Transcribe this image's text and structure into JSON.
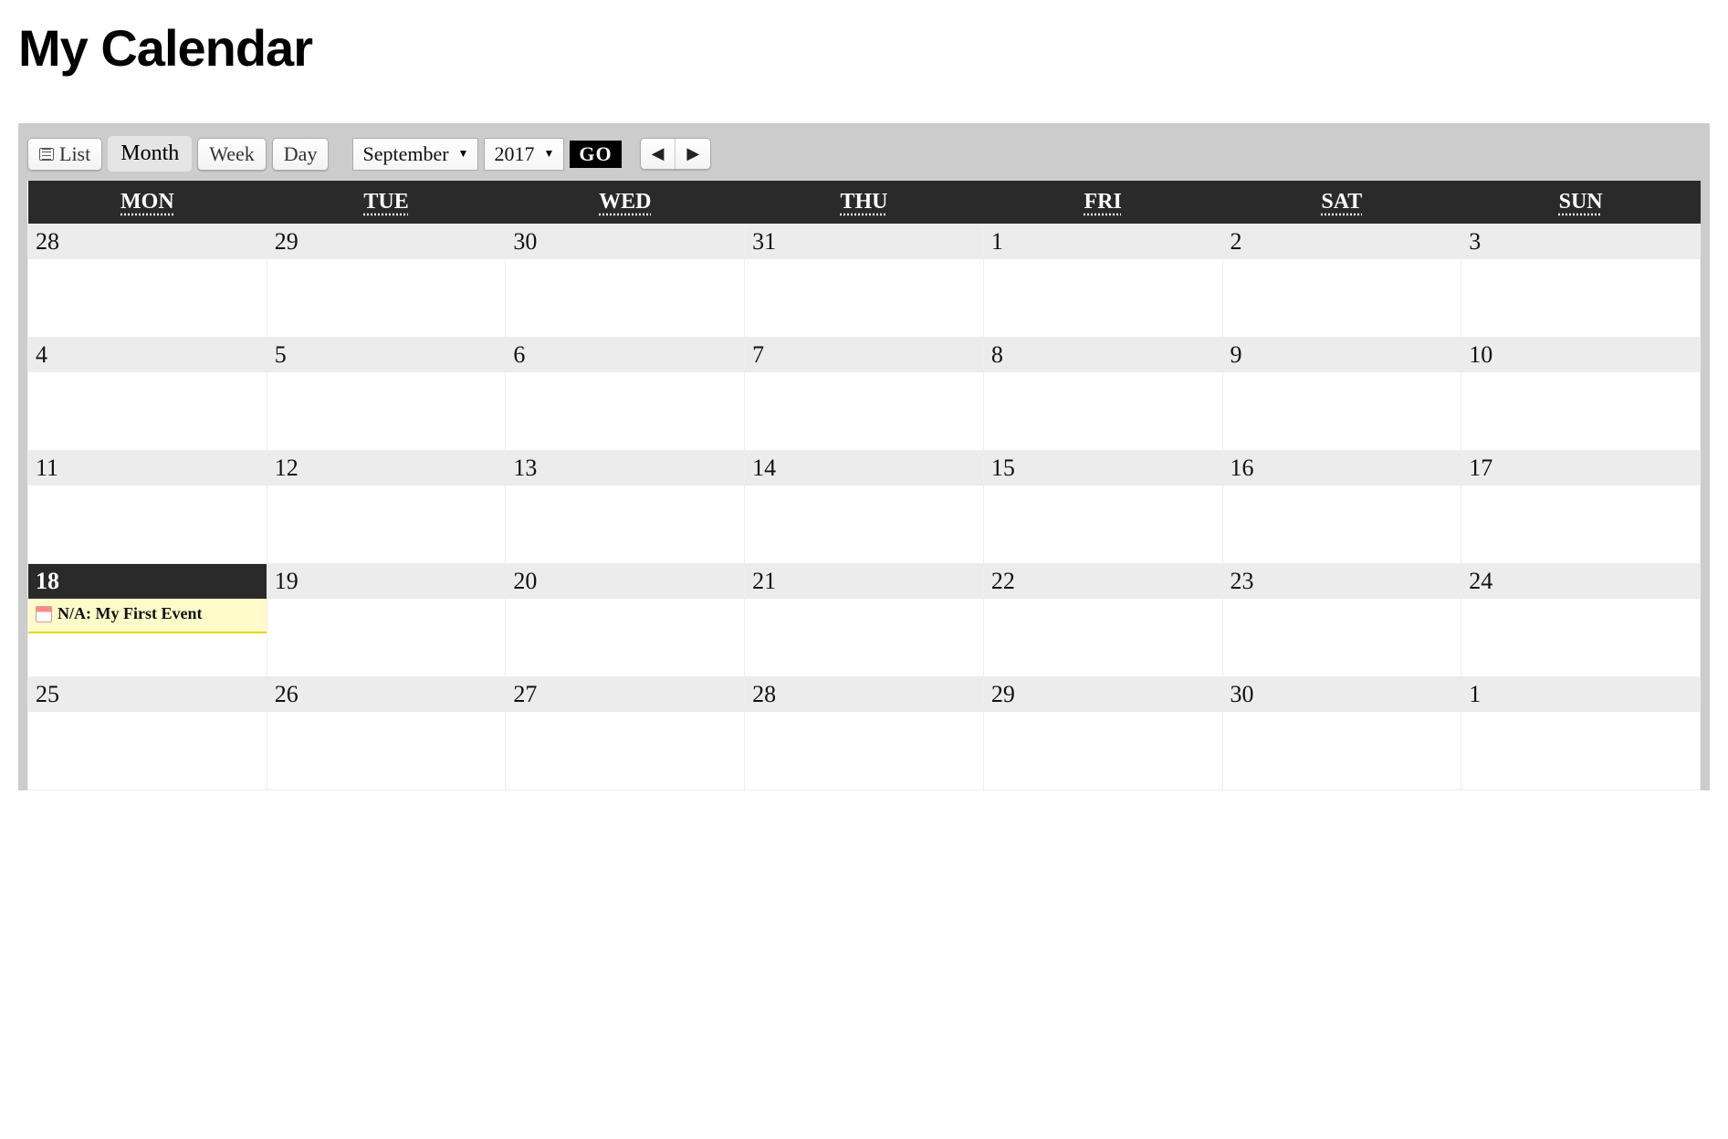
{
  "title": "My Calendar",
  "toolbar": {
    "list_label": "List",
    "month_label": "Month",
    "week_label": "Week",
    "day_label": "Day",
    "month_select": "September",
    "year_select": "2017",
    "go_label": "GO"
  },
  "headers": [
    "MON",
    "TUE",
    "WED",
    "THU",
    "FRI",
    "SAT",
    "SUN"
  ],
  "weeks": [
    [
      "28",
      "29",
      "30",
      "31",
      "1",
      "2",
      "3"
    ],
    [
      "4",
      "5",
      "6",
      "7",
      "8",
      "9",
      "10"
    ],
    [
      "11",
      "12",
      "13",
      "14",
      "15",
      "16",
      "17"
    ],
    [
      "18",
      "19",
      "20",
      "21",
      "22",
      "23",
      "24"
    ],
    [
      "25",
      "26",
      "27",
      "28",
      "29",
      "30",
      "1"
    ]
  ],
  "today": "18",
  "event": {
    "day": "18",
    "text": "N/A: My First Event"
  }
}
